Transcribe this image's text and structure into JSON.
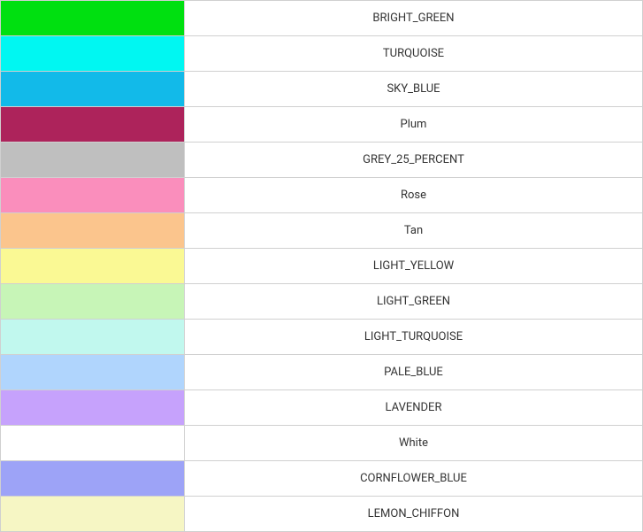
{
  "colors": [
    {
      "name": "BRIGHT_GREEN",
      "hex": "#00E010"
    },
    {
      "name": "TURQUOISE",
      "hex": "#00F7F2"
    },
    {
      "name": "SKY_BLUE",
      "hex": "#12BAE9"
    },
    {
      "name": "Plum",
      "hex": "#AD235B"
    },
    {
      "name": "GREY_25_PERCENT",
      "hex": "#BFBFBF"
    },
    {
      "name": "Rose",
      "hex": "#FA8EBC"
    },
    {
      "name": "Tan",
      "hex": "#FBC58D"
    },
    {
      "name": "LIGHT_YELLOW",
      "hex": "#FAF994"
    },
    {
      "name": "LIGHT_GREEN",
      "hex": "#C7F5B7"
    },
    {
      "name": "LIGHT_TURQUOISE",
      "hex": "#C1F8EE"
    },
    {
      "name": "PALE_BLUE",
      "hex": "#B0D5FD"
    },
    {
      "name": "LAVENDER",
      "hex": "#C6A2FC"
    },
    {
      "name": "White",
      "hex": "#FFFFFF"
    },
    {
      "name": "CORNFLOWER_BLUE",
      "hex": "#9DA3F7"
    },
    {
      "name": "LEMON_CHIFFON",
      "hex": "#F6F6C4"
    }
  ]
}
